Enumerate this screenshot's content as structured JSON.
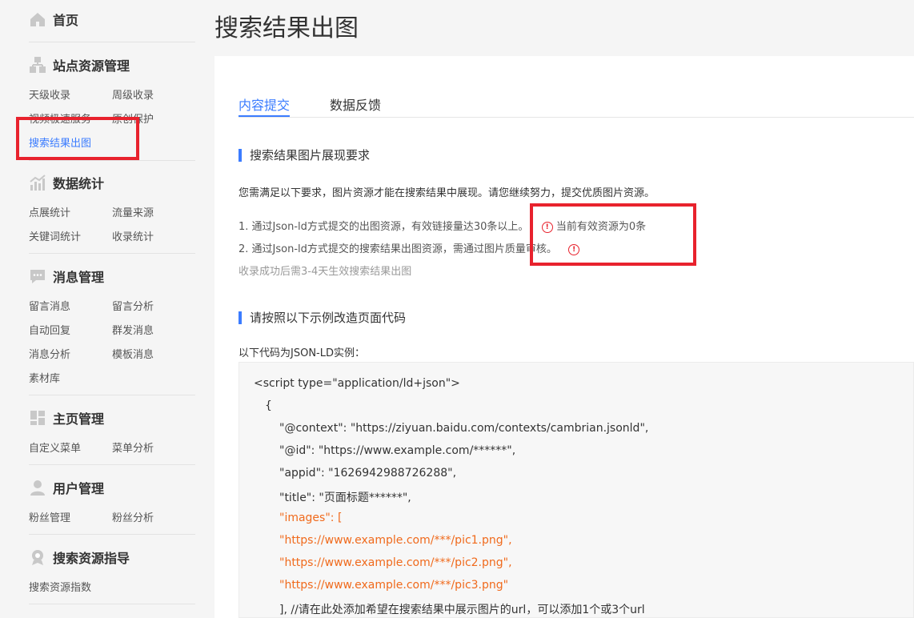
{
  "sidebar": {
    "home": {
      "label": "首页",
      "icon": "home-icon"
    },
    "sections": [
      {
        "title": "站点资源管理",
        "icon": "sitemap-icon",
        "items": [
          "天级收录",
          "周级收录",
          "视频极速服务",
          "原创保护",
          "搜索结果出图"
        ]
      },
      {
        "title": "数据统计",
        "icon": "chart-icon",
        "items": [
          "点展统计",
          "流量来源",
          "关键词统计",
          "收录统计"
        ]
      },
      {
        "title": "消息管理",
        "icon": "message-icon",
        "items": [
          "留言消息",
          "留言分析",
          "自动回复",
          "群发消息",
          "消息分析",
          "模板消息",
          "素材库"
        ]
      },
      {
        "title": "主页管理",
        "icon": "layout-icon",
        "items": [
          "自定义菜单",
          "菜单分析"
        ]
      },
      {
        "title": "用户管理",
        "icon": "user-icon",
        "items": [
          "粉丝管理",
          "粉丝分析"
        ]
      },
      {
        "title": "搜索资源指导",
        "icon": "search-guide-icon",
        "items": [
          "搜索资源指数"
        ]
      }
    ]
  },
  "main": {
    "title": "搜索结果出图",
    "tabs": [
      "内容提交",
      "数据反馈"
    ],
    "section1": {
      "heading": "搜索结果图片展现要求",
      "desc": "您需满足以下要求，图片资源才能在搜索结果中展现。请您继续努力，提交优质图片资源。",
      "req1": "1. 通过Json-ld方式提交的出图资源，有效链接量达30条以上。",
      "req1_status": "当前有效资源为0条",
      "req2": "2. 通过Json-ld方式提交的搜索结果出图资源，需通过图片质量审核。",
      "note": "收录成功后需3-4天生效搜索结果出图"
    },
    "section2": {
      "heading": "请按照以下示例改造页面代码",
      "intro": "以下代码为JSON-LD实例：",
      "code": [
        "<script type=\"application/ld+json\">",
        "{",
        "\"@context\": \"https://ziyuan.baidu.com/contexts/cambrian.jsonld\",",
        "\"@id\": \"https://www.example.com/******\",",
        "\"appid\": \"1626942988726288\",",
        "\"title\": \"页面标题******\",",
        "\"images\": [",
        "\"https://www.example.com/***/pic1.png\",",
        "\"https://www.example.com/***/pic2.png\",",
        "\"https://www.example.com/***/pic3.png\"",
        "], //请在此处添加希望在搜索结果中展示图片的url，可以添加1个或3个url"
      ]
    }
  },
  "colors": {
    "accent": "#3b7cff",
    "highlight": "#e8222d",
    "code_orange": "#f06a1c"
  }
}
